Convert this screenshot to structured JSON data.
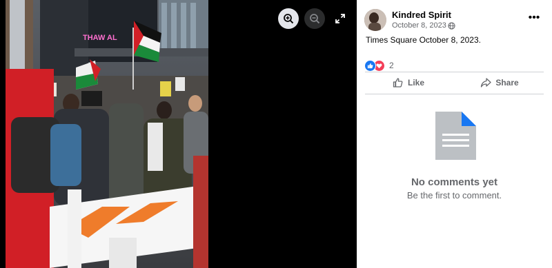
{
  "post": {
    "author": "Kindred Spirit",
    "date": "October 8, 2023 ·",
    "text": "Times Square October 8, 2023.",
    "reaction_count": "2"
  },
  "actions": {
    "like_label": "Like",
    "share_label": "Share",
    "more_label": "•••"
  },
  "comments": {
    "empty_title": "No comments yet",
    "empty_subtitle": "Be the first to comment."
  },
  "photo_sign_text": "THAW AL",
  "icons": {
    "zoom_in": "zoom-in-icon",
    "zoom_out": "zoom-out-icon",
    "fullscreen": "fullscreen-icon",
    "globe": "globe-icon",
    "like": "thumbs-up-icon",
    "share": "share-arrow-icon",
    "empty_comments": "document-icon"
  },
  "colors": {
    "accent": "#1877f2",
    "love": "#f33e58",
    "secondary_text": "#65676b",
    "primary_text": "#050505",
    "doc_gray": "#bcc0c4"
  }
}
